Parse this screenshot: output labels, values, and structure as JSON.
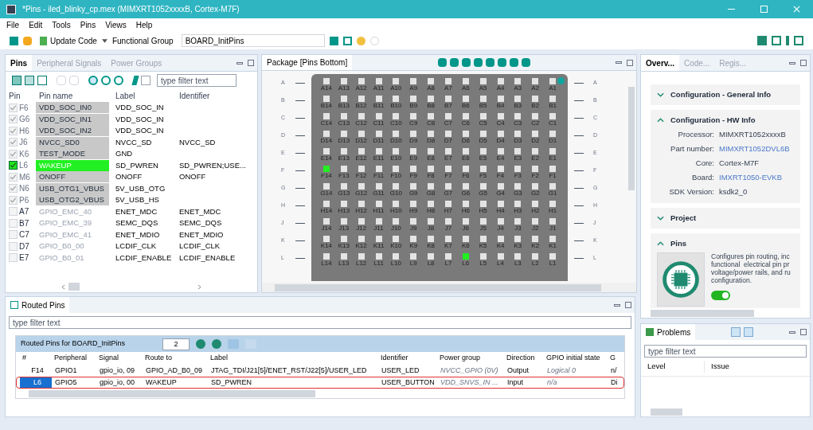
{
  "window": {
    "title": "*Pins - iled_blinky_cp.mex (MIMXRT1052xxxxB, Cortex-M7F)"
  },
  "package_row_letters_right": [
    "A",
    "B",
    "C",
    "D",
    "E",
    "F",
    "G",
    "H",
    "J",
    "K",
    "L"
  ],
  "menu": [
    "File",
    "Edit",
    "Tools",
    "Pins",
    "Views",
    "Help"
  ],
  "toolbar": {
    "update_code": "Update Code",
    "functional_group_label": "Functional Group",
    "functional_group": "BOARD_InitPins"
  },
  "pins_panel": {
    "tabs": [
      {
        "label": "Pins",
        "selected": true
      },
      {
        "label": "Peripheral Signals",
        "selected": false
      },
      {
        "label": "Power Groups",
        "selected": false
      }
    ],
    "filter": {
      "placeholder": "type filter text"
    },
    "columns": [
      "Pin",
      "Pin name",
      "Label",
      "Identifier"
    ],
    "rows": [
      {
        "checked": true,
        "pin": "F6",
        "name": "VDD_SOC_IN0",
        "kind": "power",
        "label": "VDD_SOC_IN",
        "identifier": ""
      },
      {
        "checked": true,
        "pin": "G6",
        "name": "VDD_SOC_IN1",
        "kind": "power",
        "label": "VDD_SOC_IN",
        "identifier": ""
      },
      {
        "checked": true,
        "pin": "H6",
        "name": "VDD_SOC_IN2",
        "kind": "power",
        "label": "VDD_SOC_IN",
        "identifier": ""
      },
      {
        "checked": true,
        "pin": "J6",
        "name": "NVCC_SD0",
        "kind": "power",
        "label": "NVCC_SD",
        "identifier": "NVCC_SD"
      },
      {
        "checked": true,
        "pin": "K6",
        "name": "TEST_MODE",
        "kind": "power",
        "label": "GND",
        "identifier": ""
      },
      {
        "checked": true,
        "pin": "L6",
        "name": "WAKEUP",
        "kind": "routed",
        "label": "SD_PWREN",
        "identifier": "SD_PWREN;USE..."
      },
      {
        "checked": true,
        "pin": "M6",
        "name": "ONOFF",
        "kind": "power",
        "label": "ONOFF",
        "identifier": "ONOFF"
      },
      {
        "checked": true,
        "pin": "N6",
        "name": "USB_OTG1_VBUS",
        "kind": "power",
        "label": "5V_USB_OTG",
        "identifier": ""
      },
      {
        "checked": true,
        "pin": "P6",
        "name": "USB_OTG2_VBUS",
        "kind": "power",
        "label": "5V_USB_HS",
        "identifier": ""
      },
      {
        "checked": false,
        "pin": "A7",
        "name": "GPIO_EMC_40",
        "kind": "gpio",
        "label": "ENET_MDC",
        "identifier": "ENET_MDC"
      },
      {
        "checked": false,
        "pin": "B7",
        "name": "GPIO_EMC_39",
        "kind": "gpio",
        "label": "SEMC_DQS",
        "identifier": "SEMC_DQS"
      },
      {
        "checked": false,
        "pin": "C7",
        "name": "GPIO_EMC_41",
        "kind": "gpio",
        "label": "ENET_MDIO",
        "identifier": "ENET_MDIO"
      },
      {
        "checked": false,
        "pin": "D7",
        "name": "GPIO_B0_00",
        "kind": "gpio",
        "label": "LCDIF_CLK",
        "identifier": "LCDIF_CLK"
      },
      {
        "checked": false,
        "pin": "E7",
        "name": "GPIO_B0_01",
        "kind": "gpio",
        "label": "LCDIF_ENABLE",
        "identifier": "LCDIF_ENABLE"
      }
    ]
  },
  "package_panel": {
    "title": "Package [Pins Bottom]",
    "rows": [
      {
        "letter": "A",
        "pins": [
          {
            "label": "A14",
            "selected": false
          },
          {
            "label": "A13",
            "selected": false
          },
          {
            "label": "A12",
            "selected": false
          },
          {
            "label": "A11",
            "selected": false
          },
          {
            "label": "A10",
            "selected": false
          },
          {
            "label": "A9",
            "selected": false
          },
          {
            "label": "A8",
            "selected": false
          },
          {
            "label": "A7",
            "selected": false
          },
          {
            "label": "A6",
            "selected": false
          },
          {
            "label": "A5",
            "selected": false
          },
          {
            "label": "A4",
            "selected": false
          },
          {
            "label": "A3",
            "selected": false
          },
          {
            "label": "A2",
            "selected": false
          },
          {
            "label": "A1",
            "selected": false
          }
        ]
      },
      {
        "letter": "B",
        "pins": [
          {
            "label": "B14",
            "selected": false
          },
          {
            "label": "B13",
            "selected": false
          },
          {
            "label": "B12",
            "selected": false
          },
          {
            "label": "B11",
            "selected": false
          },
          {
            "label": "B10",
            "selected": false
          },
          {
            "label": "B9",
            "selected": false
          },
          {
            "label": "B8",
            "selected": false
          },
          {
            "label": "B7",
            "selected": false
          },
          {
            "label": "B6",
            "selected": false
          },
          {
            "label": "B5",
            "selected": false
          },
          {
            "label": "B4",
            "selected": false
          },
          {
            "label": "B3",
            "selected": false
          },
          {
            "label": "B2",
            "selected": false
          },
          {
            "label": "B1",
            "selected": false
          }
        ]
      },
      {
        "letter": "C",
        "pins": [
          {
            "label": "C14",
            "selected": false
          },
          {
            "label": "C13",
            "selected": false
          },
          {
            "label": "C12",
            "selected": false
          },
          {
            "label": "C11",
            "selected": false
          },
          {
            "label": "C10",
            "selected": false
          },
          {
            "label": "C9",
            "selected": false
          },
          {
            "label": "C8",
            "selected": false
          },
          {
            "label": "C7",
            "selected": false
          },
          {
            "label": "C6",
            "selected": false
          },
          {
            "label": "C5",
            "selected": false
          },
          {
            "label": "C4",
            "selected": false
          },
          {
            "label": "C3",
            "selected": false
          },
          {
            "label": "C2",
            "selected": false
          },
          {
            "label": "C1",
            "selected": false
          }
        ]
      },
      {
        "letter": "D",
        "pins": [
          {
            "label": "D14",
            "selected": false
          },
          {
            "label": "D13",
            "selected": false
          },
          {
            "label": "D12",
            "selected": false
          },
          {
            "label": "D11",
            "selected": false
          },
          {
            "label": "D10",
            "selected": false
          },
          {
            "label": "D9",
            "selected": false
          },
          {
            "label": "D8",
            "selected": false
          },
          {
            "label": "D7",
            "selected": false
          },
          {
            "label": "D6",
            "selected": false
          },
          {
            "label": "D5",
            "selected": false
          },
          {
            "label": "D4",
            "selected": false
          },
          {
            "label": "D3",
            "selected": false
          },
          {
            "label": "D2",
            "selected": false
          },
          {
            "label": "D1",
            "selected": false
          }
        ]
      },
      {
        "letter": "E",
        "pins": [
          {
            "label": "E14",
            "selected": false
          },
          {
            "label": "E13",
            "selected": false
          },
          {
            "label": "E12",
            "selected": false
          },
          {
            "label": "E11",
            "selected": false
          },
          {
            "label": "E10",
            "selected": false
          },
          {
            "label": "E9",
            "selected": false
          },
          {
            "label": "E8",
            "selected": false
          },
          {
            "label": "E7",
            "selected": false
          },
          {
            "label": "E6",
            "selected": false
          },
          {
            "label": "E5",
            "selected": false
          },
          {
            "label": "E4",
            "selected": false
          },
          {
            "label": "E3",
            "selected": false
          },
          {
            "label": "E2",
            "selected": false
          },
          {
            "label": "E1",
            "selected": false
          }
        ]
      },
      {
        "letter": "F",
        "pins": [
          {
            "label": "F14",
            "selected": true
          },
          {
            "label": "F13",
            "selected": false
          },
          {
            "label": "F12",
            "selected": false
          },
          {
            "label": "F11",
            "selected": false
          },
          {
            "label": "F10",
            "selected": false
          },
          {
            "label": "F9",
            "selected": false
          },
          {
            "label": "F8",
            "selected": false
          },
          {
            "label": "F7",
            "selected": false
          },
          {
            "label": "F6",
            "selected": false
          },
          {
            "label": "F5",
            "selected": false
          },
          {
            "label": "F4",
            "selected": false
          },
          {
            "label": "F3",
            "selected": false
          },
          {
            "label": "F2",
            "selected": false
          },
          {
            "label": "F1",
            "selected": false
          }
        ]
      },
      {
        "letter": "G",
        "pins": [
          {
            "label": "G14",
            "selected": false
          },
          {
            "label": "G13",
            "selected": false
          },
          {
            "label": "G12",
            "selected": false
          },
          {
            "label": "G11",
            "selected": false
          },
          {
            "label": "G10",
            "selected": false
          },
          {
            "label": "G9",
            "selected": false
          },
          {
            "label": "G8",
            "selected": false
          },
          {
            "label": "G7",
            "selected": false
          },
          {
            "label": "G6",
            "selected": false
          },
          {
            "label": "G5",
            "selected": false
          },
          {
            "label": "G4",
            "selected": false
          },
          {
            "label": "G3",
            "selected": false
          },
          {
            "label": "G2",
            "selected": false
          },
          {
            "label": "G1",
            "selected": false
          }
        ]
      },
      {
        "letter": "H",
        "pins": [
          {
            "label": "H14",
            "selected": false
          },
          {
            "label": "H13",
            "selected": false
          },
          {
            "label": "H12",
            "selected": false
          },
          {
            "label": "H11",
            "selected": false
          },
          {
            "label": "H10",
            "selected": false
          },
          {
            "label": "H9",
            "selected": false
          },
          {
            "label": "H8",
            "selected": false
          },
          {
            "label": "H7",
            "selected": false
          },
          {
            "label": "H6",
            "selected": false
          },
          {
            "label": "H5",
            "selected": false
          },
          {
            "label": "H4",
            "selected": false
          },
          {
            "label": "H3",
            "selected": false
          },
          {
            "label": "H2",
            "selected": false
          },
          {
            "label": "H1",
            "selected": false
          }
        ]
      },
      {
        "letter": "J",
        "pins": [
          {
            "label": "J14",
            "selected": false
          },
          {
            "label": "J13",
            "selected": false
          },
          {
            "label": "J12",
            "selected": false
          },
          {
            "label": "J11",
            "selected": false
          },
          {
            "label": "J10",
            "selected": false
          },
          {
            "label": "J9",
            "selected": false
          },
          {
            "label": "J8",
            "selected": false
          },
          {
            "label": "J7",
            "selected": false
          },
          {
            "label": "J6",
            "selected": false
          },
          {
            "label": "J5",
            "selected": false
          },
          {
            "label": "J4",
            "selected": false
          },
          {
            "label": "J3",
            "selected": false
          },
          {
            "label": "J2",
            "selected": false
          },
          {
            "label": "J1",
            "selected": false
          }
        ]
      },
      {
        "letter": "K",
        "pins": [
          {
            "label": "K14",
            "selected": false
          },
          {
            "label": "K13",
            "selected": false
          },
          {
            "label": "K12",
            "selected": false
          },
          {
            "label": "K11",
            "selected": false
          },
          {
            "label": "K10",
            "selected": false
          },
          {
            "label": "K9",
            "selected": false
          },
          {
            "label": "K8",
            "selected": false
          },
          {
            "label": "K7",
            "selected": false
          },
          {
            "label": "K6",
            "selected": false
          },
          {
            "label": "K5",
            "selected": false
          },
          {
            "label": "K4",
            "selected": false
          },
          {
            "label": "K3",
            "selected": false
          },
          {
            "label": "K2",
            "selected": false
          },
          {
            "label": "K1",
            "selected": false
          }
        ]
      },
      {
        "letter": "L",
        "pins": [
          {
            "label": "L14",
            "selected": false
          },
          {
            "label": "L13",
            "selected": false
          },
          {
            "label": "L12",
            "selected": false
          },
          {
            "label": "L11",
            "selected": false
          },
          {
            "label": "L10",
            "selected": false
          },
          {
            "label": "L9",
            "selected": false
          },
          {
            "label": "L8",
            "selected": false
          },
          {
            "label": "L7",
            "selected": false
          },
          {
            "label": "L6",
            "selected": true
          },
          {
            "label": "L5",
            "selected": false
          },
          {
            "label": "L4",
            "selected": false
          },
          {
            "label": "L3",
            "selected": false
          },
          {
            "label": "L2",
            "selected": false
          },
          {
            "label": "L1",
            "selected": false
          }
        ]
      }
    ]
  },
  "overview_panel": {
    "tabs": [
      {
        "label": "Overv...",
        "selected": true
      },
      {
        "label": "Code...",
        "selected": false
      },
      {
        "label": "Regis...",
        "selected": false
      }
    ],
    "sections": [
      {
        "title": "Configuration - General Info",
        "expanded": false
      },
      {
        "title": "Configuration - HW Info",
        "expanded": true,
        "fields": [
          {
            "name": "Processor:",
            "value": "MIMXRT1052xxxxB",
            "link": false
          },
          {
            "name": "Part number:",
            "value": "MIMXRT1052DVL6B",
            "link": true
          },
          {
            "name": "Core:",
            "value": "Cortex-M7F",
            "link": false
          },
          {
            "name": "Board:",
            "value": "IMXRT1050-EVKB",
            "link": true
          },
          {
            "name": "SDK Version:",
            "value": "ksdk2_0",
            "link": false
          }
        ]
      },
      {
        "title": "Project",
        "expanded": false
      },
      {
        "title": "Pins",
        "expanded": true,
        "description": [
          "Configures pin routing, inc",
          "functional  electrical pin pr",
          "voltage/power rails, and ru",
          "configuration."
        ],
        "enabled": true
      }
    ]
  },
  "routed_pins_panel": {
    "title": "Routed Pins",
    "filter": {
      "placeholder": "type filter text"
    },
    "table_title": "Routed Pins for BOARD_InitPins",
    "count": "2",
    "columns": [
      "#",
      "Peripheral",
      "Signal",
      "Route to",
      "Label",
      "Identifier",
      "Power group",
      "Direction",
      "GPIO initial state",
      "G"
    ],
    "rows": [
      {
        "selected": false,
        "cells": [
          "F14",
          "GPIO1",
          "gpio_io, 09",
          "GPIO_AD_B0_09",
          "JTAG_TDI/J21[5]/ENET_RST/J22[5]/USER_LED",
          "USER_LED",
          "NVCC_GPIO (0V)",
          "Output",
          "Logical 0",
          "n/"
        ]
      },
      {
        "selected": true,
        "cells": [
          "L6",
          "GPIO5",
          "gpio_io, 00",
          "WAKEUP",
          "SD_PWREN",
          "USER_BUTTON",
          "VDD_SNVS_IN ...",
          "Input",
          "n/a",
          "Di"
        ]
      }
    ]
  },
  "problems_panel": {
    "title": "Problems",
    "filter": {
      "placeholder": "type filter text"
    },
    "columns": [
      "Level",
      "Issue"
    ]
  }
}
